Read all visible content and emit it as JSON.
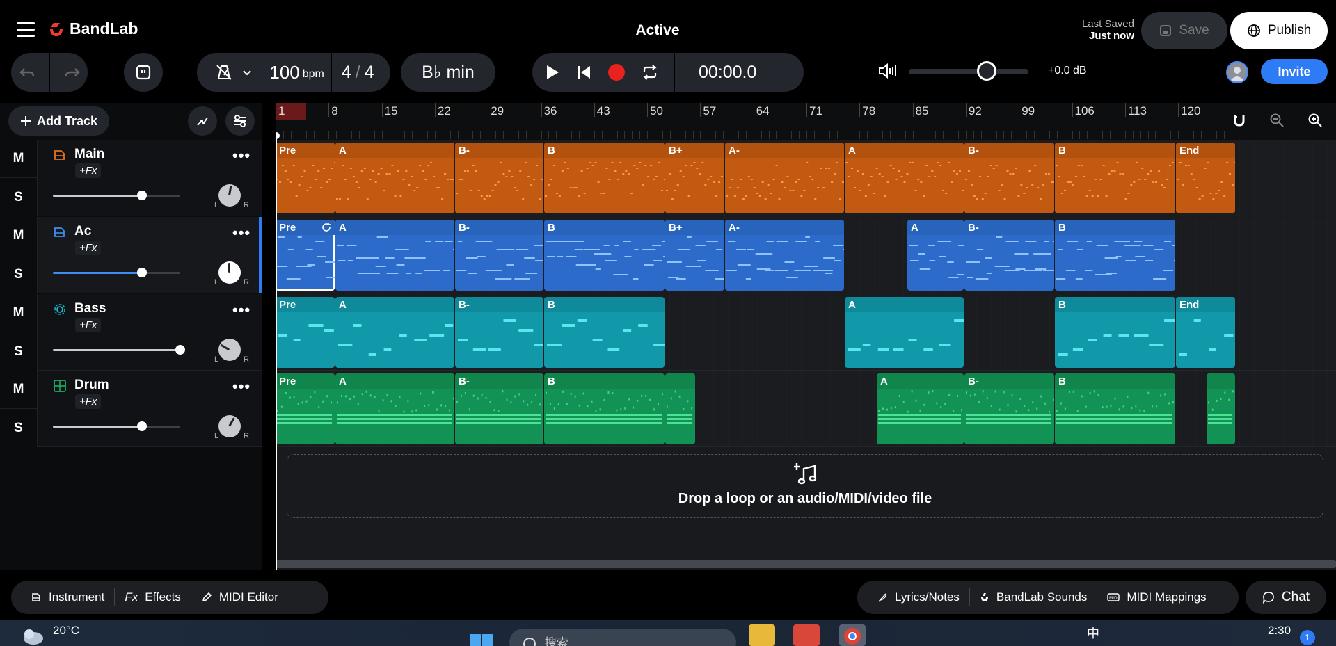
{
  "app": {
    "name": "BandLab",
    "project_title": "Active",
    "last_saved_label": "Last Saved",
    "last_saved_value": "Just now",
    "save_label": "Save",
    "publish_label": "Publish",
    "invite_label": "Invite"
  },
  "transport": {
    "tempo_value": "100",
    "tempo_unit": "bpm",
    "time_sig_num": "4",
    "time_sig_sep": "/",
    "time_sig_den": "4",
    "key": "B♭ min",
    "time": "00:00.0",
    "volume_db": "+0.0 dB",
    "volume_level": 0.6
  },
  "left_panel": {
    "add_track_label": "Add Track",
    "tracks": [
      {
        "name": "Main",
        "fx": "+Fx",
        "mute": "M",
        "solo": "S",
        "more": "•••",
        "pan_left": "L",
        "pan_right": "R",
        "volume": 0.7,
        "color": "#e8731c",
        "icon": "keyboard-icon"
      },
      {
        "name": "Ac",
        "fx": "+Fx",
        "mute": "M",
        "solo": "S",
        "more": "•••",
        "pan_left": "L",
        "pan_right": "R",
        "volume": 0.7,
        "color": "#3d8ef0",
        "icon": "keyboard-icon"
      },
      {
        "name": "Bass",
        "fx": "+Fx",
        "mute": "M",
        "solo": "S",
        "more": "•••",
        "pan_left": "L",
        "pan_right": "R",
        "volume": 1.0,
        "color": "#18b6c7",
        "icon": "synth-icon"
      },
      {
        "name": "Drum",
        "fx": "+Fx",
        "mute": "M",
        "solo": "S",
        "more": "•••",
        "pan_left": "L",
        "pan_right": "R",
        "volume": 0.7,
        "color": "#19b065",
        "icon": "drum-pad-icon"
      }
    ]
  },
  "ruler": {
    "numbers": [
      "1",
      "8",
      "15",
      "22",
      "29",
      "36",
      "43",
      "50",
      "57",
      "64",
      "71",
      "78",
      "85",
      "92",
      "99",
      "106",
      "113",
      "120"
    ]
  },
  "clips": {
    "main": [
      "Pre",
      "A",
      "B-",
      "B",
      "B+",
      "A-",
      "A",
      "B-",
      "B",
      "End"
    ],
    "ac": [
      "Pre",
      "A",
      "B-",
      "B",
      "B+",
      "A-",
      "A",
      "B-",
      "B"
    ],
    "bass": [
      "Pre",
      "A",
      "B-",
      "B",
      "A",
      "B",
      "End"
    ],
    "drum": [
      "Pre",
      "A",
      "B-",
      "B",
      "",
      "A",
      "B-",
      "B",
      ""
    ]
  },
  "dropzone": {
    "text": "Drop a loop or an audio/MIDI/video file"
  },
  "bottom_bar": {
    "instrument": "Instrument",
    "fx_prefix": "Fx",
    "effects": "Effects",
    "midi_editor": "MIDI Editor",
    "lyrics": "Lyrics/Notes",
    "sounds": "BandLab Sounds",
    "midi_mappings": "MIDI Mappings",
    "chat": "Chat"
  },
  "taskbar": {
    "temperature": "20°C",
    "search_placeholder": "搜索",
    "time": "2:30",
    "ime": "中",
    "notification_count": "1"
  },
  "colors": {
    "accent": "#2e7bf6",
    "main_clip": "#c25a12",
    "ac_clip": "#2c6bc9",
    "bass_clip": "#1198a9",
    "drum_clip": "#139255",
    "record": "#e8231f"
  }
}
